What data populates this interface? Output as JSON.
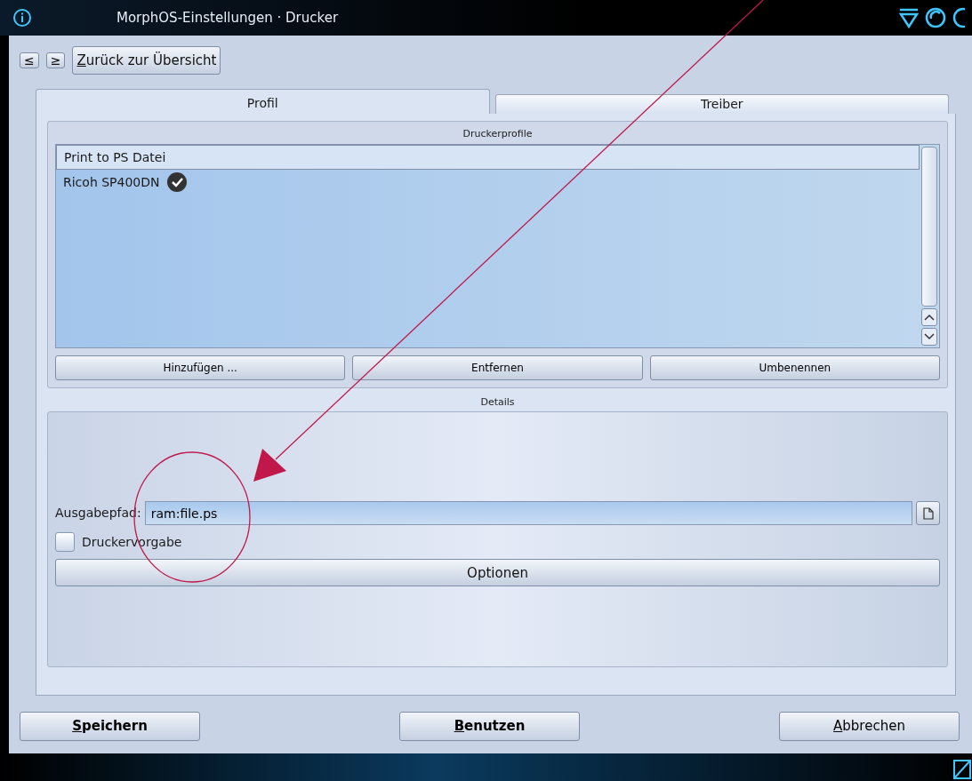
{
  "window": {
    "title": "MorphOS-Einstellungen · Drucker"
  },
  "nav": {
    "back": "≤",
    "forward": "≥",
    "overview": {
      "label": "Zurück zur Übersicht",
      "mnemonic": true
    }
  },
  "tabs": [
    {
      "label": "Profil",
      "selected": true
    },
    {
      "label": "Treiber",
      "selected": false
    }
  ],
  "profiles": {
    "title": "Druckerprofile",
    "items": [
      {
        "label": "Print to PS Datei",
        "selected": true,
        "default": false
      },
      {
        "label": "Ricoh SP400DN",
        "selected": false,
        "default": true
      }
    ],
    "buttons": [
      "Hinzufügen ...",
      "Entfernen",
      "Umbenennen"
    ]
  },
  "details": {
    "title": "Details",
    "output_label": "Ausgabepfad:",
    "output_value": "ram:file.ps",
    "printer_default": {
      "label": "Druckervorgabe",
      "checked": false
    },
    "options_button": "Optionen"
  },
  "footer_buttons": [
    {
      "label": "Speichern",
      "mnemonic": true,
      "bold": true
    },
    {
      "label": "Benutzen",
      "mnemonic": true,
      "bold": true
    },
    {
      "label": "Abbrechen",
      "mnemonic": true,
      "bold": false
    }
  ]
}
